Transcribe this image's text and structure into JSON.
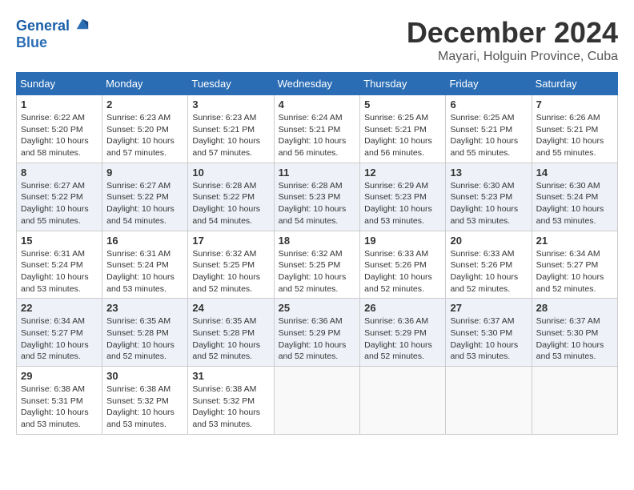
{
  "header": {
    "logo_line1": "General",
    "logo_line2": "Blue",
    "month_title": "December 2024",
    "location": "Mayari, Holguin Province, Cuba"
  },
  "calendar": {
    "headers": [
      "Sunday",
      "Monday",
      "Tuesday",
      "Wednesday",
      "Thursday",
      "Friday",
      "Saturday"
    ],
    "weeks": [
      [
        {
          "day": "",
          "info": ""
        },
        {
          "day": "2",
          "info": "Sunrise: 6:23 AM\nSunset: 5:20 PM\nDaylight: 10 hours\nand 57 minutes."
        },
        {
          "day": "3",
          "info": "Sunrise: 6:23 AM\nSunset: 5:21 PM\nDaylight: 10 hours\nand 57 minutes."
        },
        {
          "day": "4",
          "info": "Sunrise: 6:24 AM\nSunset: 5:21 PM\nDaylight: 10 hours\nand 56 minutes."
        },
        {
          "day": "5",
          "info": "Sunrise: 6:25 AM\nSunset: 5:21 PM\nDaylight: 10 hours\nand 56 minutes."
        },
        {
          "day": "6",
          "info": "Sunrise: 6:25 AM\nSunset: 5:21 PM\nDaylight: 10 hours\nand 55 minutes."
        },
        {
          "day": "7",
          "info": "Sunrise: 6:26 AM\nSunset: 5:21 PM\nDaylight: 10 hours\nand 55 minutes."
        }
      ],
      [
        {
          "day": "1",
          "info": "Sunrise: 6:22 AM\nSunset: 5:20 PM\nDaylight: 10 hours\nand 58 minutes."
        },
        {
          "day": ""
        },
        {
          "day": ""
        },
        {
          "day": ""
        },
        {
          "day": ""
        },
        {
          "day": ""
        },
        {
          "day": ""
        }
      ],
      [
        {
          "day": "8",
          "info": "Sunrise: 6:27 AM\nSunset: 5:22 PM\nDaylight: 10 hours\nand 55 minutes."
        },
        {
          "day": "9",
          "info": "Sunrise: 6:27 AM\nSunset: 5:22 PM\nDaylight: 10 hours\nand 54 minutes."
        },
        {
          "day": "10",
          "info": "Sunrise: 6:28 AM\nSunset: 5:22 PM\nDaylight: 10 hours\nand 54 minutes."
        },
        {
          "day": "11",
          "info": "Sunrise: 6:28 AM\nSunset: 5:23 PM\nDaylight: 10 hours\nand 54 minutes."
        },
        {
          "day": "12",
          "info": "Sunrise: 6:29 AM\nSunset: 5:23 PM\nDaylight: 10 hours\nand 53 minutes."
        },
        {
          "day": "13",
          "info": "Sunrise: 6:30 AM\nSunset: 5:23 PM\nDaylight: 10 hours\nand 53 minutes."
        },
        {
          "day": "14",
          "info": "Sunrise: 6:30 AM\nSunset: 5:24 PM\nDaylight: 10 hours\nand 53 minutes."
        }
      ],
      [
        {
          "day": "15",
          "info": "Sunrise: 6:31 AM\nSunset: 5:24 PM\nDaylight: 10 hours\nand 53 minutes."
        },
        {
          "day": "16",
          "info": "Sunrise: 6:31 AM\nSunset: 5:24 PM\nDaylight: 10 hours\nand 53 minutes."
        },
        {
          "day": "17",
          "info": "Sunrise: 6:32 AM\nSunset: 5:25 PM\nDaylight: 10 hours\nand 52 minutes."
        },
        {
          "day": "18",
          "info": "Sunrise: 6:32 AM\nSunset: 5:25 PM\nDaylight: 10 hours\nand 52 minutes."
        },
        {
          "day": "19",
          "info": "Sunrise: 6:33 AM\nSunset: 5:26 PM\nDaylight: 10 hours\nand 52 minutes."
        },
        {
          "day": "20",
          "info": "Sunrise: 6:33 AM\nSunset: 5:26 PM\nDaylight: 10 hours\nand 52 minutes."
        },
        {
          "day": "21",
          "info": "Sunrise: 6:34 AM\nSunset: 5:27 PM\nDaylight: 10 hours\nand 52 minutes."
        }
      ],
      [
        {
          "day": "22",
          "info": "Sunrise: 6:34 AM\nSunset: 5:27 PM\nDaylight: 10 hours\nand 52 minutes."
        },
        {
          "day": "23",
          "info": "Sunrise: 6:35 AM\nSunset: 5:28 PM\nDaylight: 10 hours\nand 52 minutes."
        },
        {
          "day": "24",
          "info": "Sunrise: 6:35 AM\nSunset: 5:28 PM\nDaylight: 10 hours\nand 52 minutes."
        },
        {
          "day": "25",
          "info": "Sunrise: 6:36 AM\nSunset: 5:29 PM\nDaylight: 10 hours\nand 52 minutes."
        },
        {
          "day": "26",
          "info": "Sunrise: 6:36 AM\nSunset: 5:29 PM\nDaylight: 10 hours\nand 52 minutes."
        },
        {
          "day": "27",
          "info": "Sunrise: 6:37 AM\nSunset: 5:30 PM\nDaylight: 10 hours\nand 53 minutes."
        },
        {
          "day": "28",
          "info": "Sunrise: 6:37 AM\nSunset: 5:30 PM\nDaylight: 10 hours\nand 53 minutes."
        }
      ],
      [
        {
          "day": "29",
          "info": "Sunrise: 6:38 AM\nSunset: 5:31 PM\nDaylight: 10 hours\nand 53 minutes."
        },
        {
          "day": "30",
          "info": "Sunrise: 6:38 AM\nSunset: 5:32 PM\nDaylight: 10 hours\nand 53 minutes."
        },
        {
          "day": "31",
          "info": "Sunrise: 6:38 AM\nSunset: 5:32 PM\nDaylight: 10 hours\nand 53 minutes."
        },
        {
          "day": "",
          "info": ""
        },
        {
          "day": "",
          "info": ""
        },
        {
          "day": "",
          "info": ""
        },
        {
          "day": "",
          "info": ""
        }
      ]
    ]
  }
}
